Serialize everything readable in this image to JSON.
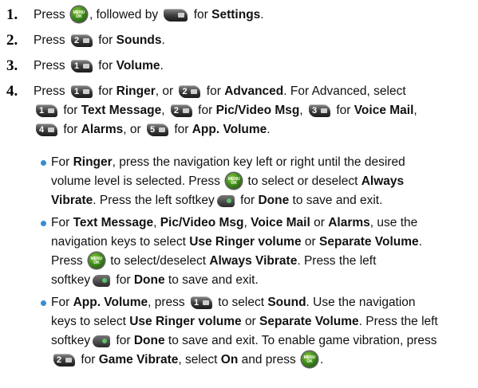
{
  "steps": [
    {
      "number": "1.",
      "t1": "Press",
      "t2": ", followed by",
      "t3": "for",
      "b1": "Settings",
      "t4": "."
    },
    {
      "number": "2.",
      "t1": "Press",
      "key1": "2",
      "t2": "for",
      "b1": "Sounds",
      "t3": "."
    },
    {
      "number": "3.",
      "t1": "Press",
      "key1": "1",
      "t2": "for",
      "b1": "Volume",
      "t3": "."
    },
    {
      "number": "4.",
      "t1": "Press",
      "key1": "1",
      "t2": "for",
      "b1": "Ringer",
      "t3": ", or",
      "key2": "2",
      "t4": "for",
      "b2": "Advanced",
      "t5": ". For Advanced, select",
      "key3": "1",
      "t6": "for",
      "b3": "Text Message",
      "t7": ",",
      "key4": "2",
      "t8": "for",
      "b4": "Pic/Video Msg",
      "t9": ",",
      "key5": "3",
      "t10": "for",
      "b5": "Voice Mail",
      "t11": ",",
      "key6": "4",
      "t12": "for",
      "b6": "Alarms",
      "t13": ", or",
      "key7": "5",
      "t14": "for",
      "b7": "App. Volume",
      "t15": "."
    }
  ],
  "bullets": [
    {
      "t1": "For",
      "b1": "Ringer",
      "t2": ", press the navigation key left or right until the desired",
      "t3": "volume level is selected. Press",
      "t4": "to select or deselect",
      "b2": "Always",
      "b3": "Vibrate",
      "t5": ". Press the left softkey",
      "t6": "for",
      "b4": "Done",
      "t7": "to save and exit."
    },
    {
      "t1": "For",
      "b1": "Text Message",
      "t2": ",",
      "b2": "Pic/Video Msg",
      "t3": ",",
      "b3": "Voice Mail",
      "t4": "or",
      "b4": "Alarms",
      "t5": ", use the",
      "t6": "navigation keys to select",
      "b5": "Use Ringer volume",
      "t7": "or",
      "b6": "Separate Volume",
      "t8": ".",
      "t9": "Press",
      "t10": "to select/deselect",
      "b7": "Always Vibrate",
      "t11": ". Press the left",
      "t12": "softkey",
      "t13": "for",
      "b8": "Done",
      "t14": "to save and exit."
    },
    {
      "t1": "For",
      "b1": "App. Volume",
      "t2": ", press",
      "t3": "to select",
      "b2": "Sound",
      "t4": ". Use the navigation",
      "t5": "keys to select",
      "b3": "Use Ringer volume",
      "t6": "or",
      "b4": "Separate Volume",
      "t7": ". Press the left",
      "t8": "softkey",
      "t9": "for",
      "b5": "Done",
      "t10": "to save and exit. To enable game vibration, press",
      "key1": "2",
      "t11": "for",
      "b6": "Game Vibrate",
      "t12": ", select",
      "b7": "On",
      "t13": "and press",
      "t14": "."
    }
  ],
  "icons": {
    "menu_ok": "MENU OK",
    "accent": "#3a8ccf"
  }
}
